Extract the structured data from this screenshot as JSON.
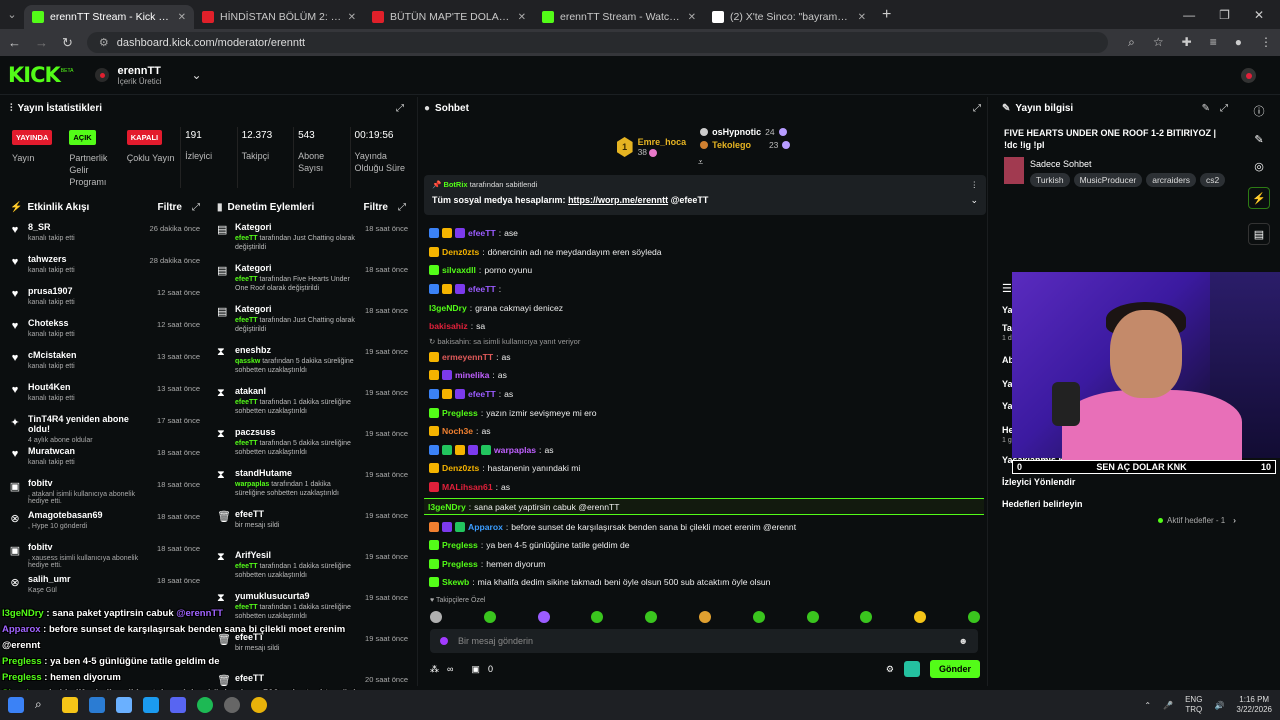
{
  "browser": {
    "tabs": [
      {
        "label": "erennTT Stream - Kick Dashboard",
        "color": "#53fc18",
        "active": true
      },
      {
        "label": "HİNDİSTAN BÖLÜM 2: VARANASİ",
        "color": "#e0202a",
        "active": false
      },
      {
        "label": "BÜTÜN MAP'TE DOLAŞTIK! w/Kendine...",
        "color": "#e0202a",
        "active": false
      },
      {
        "label": "erennTT Stream - Watch Live on Kick",
        "color": "#53fc18",
        "active": false
      },
      {
        "label": "(2) X'te Sinco: \"bayramda 5tl harçlık...",
        "color": "#ffffff",
        "active": false
      }
    ],
    "url": "dashboard.kick.com/moderator/erenntt"
  },
  "header": {
    "logo": "KICK",
    "beta": "BETA",
    "channel_name": "erennTT",
    "channel_role": "İçerik Üretici"
  },
  "stats": {
    "title": "Yayın İstatistikleri",
    "badges": [
      {
        "pill": "YAYINDA",
        "label": "Yayın",
        "color": "red"
      },
      {
        "pill": "AÇIK",
        "label": "Partnerlik Gelir Programı",
        "color": "green"
      },
      {
        "pill": "KAPALI",
        "label": "Çoklu Yayın",
        "color": "red"
      }
    ],
    "numbers": [
      {
        "value": "191",
        "label": "İzleyici"
      },
      {
        "value": "12.373",
        "label": "Takipçi"
      },
      {
        "value": "543",
        "label": "Abone Sayısı"
      },
      {
        "value": "00:19:56",
        "label": "Yayında Olduğu Süre"
      }
    ]
  },
  "activity": {
    "title": "Etkinlik Akışı",
    "filter": "Filtre",
    "items": [
      {
        "icon": "heart-icon",
        "glyph": "♥",
        "who": "8_SR",
        "what": "kanalı takip etti",
        "when": "26 dakika önce"
      },
      {
        "icon": "heart-icon",
        "glyph": "♥",
        "who": "tahwzers",
        "what": "kanalı takip etti",
        "when": "28 dakika önce"
      },
      {
        "icon": "heart-icon",
        "glyph": "♥",
        "who": "prusa1907",
        "what": "kanalı takip etti",
        "when": "12 saat önce"
      },
      {
        "icon": "heart-icon",
        "glyph": "♥",
        "who": "Chotekss",
        "what": "kanalı takip etti",
        "when": "12 saat önce"
      },
      {
        "icon": "heart-icon",
        "glyph": "♥",
        "who": "cMcistaken",
        "what": "kanalı takip etti",
        "when": "13 saat önce"
      },
      {
        "icon": "heart-icon",
        "glyph": "♥",
        "who": "Hout4Ken",
        "what": "kanalı takip etti",
        "when": "13 saat önce"
      },
      {
        "icon": "sparkle-icon",
        "glyph": "✦",
        "who": "TinT4R4 yeniden abone oldu!",
        "what": "4 aylık abone oldular",
        "when": "17 saat önce"
      },
      {
        "icon": "heart-icon",
        "glyph": "♥",
        "who": "Muratwcan",
        "what": "kanalı takip etti",
        "when": "18 saat önce"
      },
      {
        "icon": "gift-icon",
        "glyph": "▣",
        "who": "fobitv",
        "what": ", atakanl isimli kullanıcıya abonelik hediye etti.",
        "when": "18 saat önce"
      },
      {
        "icon": "hype-icon",
        "glyph": "⊗",
        "who": "Amagotebasan69",
        "what": ", Hype 10 gönderdi",
        "when": "18 saat önce"
      },
      {
        "icon": "gift-icon",
        "glyph": "▣",
        "who": "fobitv",
        "what": ", xausess isimli kullanıcıya abonelik hediye etti.",
        "when": "18 saat önce"
      },
      {
        "icon": "hype-icon",
        "glyph": "⊗",
        "who": "salih_umr",
        "what": "Kaşe Gül",
        "when": "18 saat önce"
      }
    ]
  },
  "moderation": {
    "title": "Denetim Eylemleri",
    "filter": "Filtre",
    "items": [
      {
        "icon": "category-icon",
        "glyph": "▤",
        "who": "Kategori",
        "actor": "efeeTT",
        "what": " tarafından Just Chatting olarak değiştirildi",
        "when": "18 saat önce"
      },
      {
        "icon": "category-icon",
        "glyph": "▤",
        "who": "Kategori",
        "actor": "efeeTT",
        "what": " tarafından Five Hearts Under One Roof olarak değiştirildi",
        "when": "18 saat önce"
      },
      {
        "icon": "category-icon",
        "glyph": "▤",
        "who": "Kategori",
        "actor": "efeeTT",
        "what": " tarafından Just Chatting olarak değiştirildi",
        "when": "18 saat önce"
      },
      {
        "icon": "hourglass-icon",
        "glyph": "⧗",
        "who": "eneshbz",
        "actor": "qasskw",
        "what": " tarafından 5 dakika süreliğine sohbetten uzaklaştırıldı",
        "when": "19 saat önce"
      },
      {
        "icon": "hourglass-icon",
        "glyph": "⧗",
        "who": "atakanl",
        "actor": "efeeTT",
        "what": " tarafından 1 dakika süreliğine sohbetten uzaklaştırıldı",
        "when": "19 saat önce"
      },
      {
        "icon": "hourglass-icon",
        "glyph": "⧗",
        "who": "paczsuss",
        "actor": "efeeTT",
        "what": " tarafından 5 dakika süreliğine sohbetten uzaklaştırıldı",
        "when": "19 saat önce"
      },
      {
        "icon": "hourglass-icon",
        "glyph": "⧗",
        "who": "standHutame",
        "actor": "warpaplas",
        "what": " tarafından 1 dakika süreliğine sohbetten uzaklaştırıldı",
        "when": "19 saat önce"
      },
      {
        "icon": "trash-icon",
        "glyph": "🗑",
        "who": "efeeTT",
        "actor": "",
        "what": "bir mesajı sildi",
        "when": "19 saat önce"
      },
      {
        "icon": "hourglass-icon",
        "glyph": "⧗",
        "who": "ArifYesil",
        "actor": "efeeTT",
        "what": " tarafından 1 dakika süreliğine sohbetten uzaklaştırıldı",
        "when": "19 saat önce"
      },
      {
        "icon": "hourglass-icon",
        "glyph": "⧗",
        "who": "yumuklusucurta9",
        "actor": "efeeTT",
        "what": " tarafından 1 dakika süreliğine sohbetten uzaklaştırıldı",
        "when": "19 saat önce"
      },
      {
        "icon": "trash-icon",
        "glyph": "🗑",
        "who": "efeeTT",
        "actor": "",
        "what": "bir mesajı sildi",
        "when": "19 saat önce"
      },
      {
        "icon": "trash-icon",
        "glyph": "🗑",
        "who": "efeeTT",
        "actor": "",
        "what": "bir mesajı sildi",
        "when": "20 saat önce"
      }
    ]
  },
  "chat": {
    "title": "Sohbet",
    "top_gifters": [
      {
        "name": "Emre_hoca",
        "count": "38",
        "rank": "1"
      },
      {
        "name": "osHypnotic",
        "count": "24",
        "rank": "2"
      },
      {
        "name": "Tekolego",
        "count": "23",
        "rank": "3"
      }
    ],
    "pinned_by": "BotRix",
    "pinned_suffix": "tarafından sabitlendi",
    "pinned_text": "Tüm sosyal medya hesaplarım: ",
    "pinned_link": "https://worp.me/erenntt",
    "pinned_mention": " @efeeTT",
    "messages": [
      {
        "user": "efeeTT",
        "color": "#9b5cff",
        "text": "ase",
        "badges": [
          "#3b82f6",
          "#f5b400",
          "#7c3aed"
        ]
      },
      {
        "user": "Denz0zts",
        "color": "#f5b400",
        "text": "dönercinin adı ne meydandayım eren söyleda",
        "badges": [
          "#f5b400"
        ]
      },
      {
        "user": "silvaxdll",
        "color": "#53fc18",
        "text": "porno oyunu",
        "badges": [
          "#53fc18"
        ]
      },
      {
        "user": "efeeTT",
        "color": "#9b5cff",
        "text": "",
        "badges": [
          "#3b82f6",
          "#f5b400",
          "#7c3aed"
        ]
      },
      {
        "user": "l3geNDry",
        "color": "#53fc18",
        "text": "grana cakmayi denicez",
        "badges": []
      },
      {
        "user": "bakisahiz",
        "color": "#e0203a",
        "text": "sa",
        "badges": []
      },
      {
        "user": "",
        "color": "#999",
        "text": "↻ bakisahin: sa isimli kullanıcıya yanıt veriyor",
        "badges": [],
        "reply": true
      },
      {
        "user": "ermeyennTT",
        "color": "#e05a5a",
        "text": "as",
        "badges": [
          "#f5b400"
        ]
      },
      {
        "user": "minelika",
        "color": "#c060ff",
        "text": "as",
        "badges": [
          "#f5b400",
          "#7c3aed"
        ]
      },
      {
        "user": "efeeTT",
        "color": "#9b5cff",
        "text": "as",
        "badges": [
          "#3b82f6",
          "#f5b400",
          "#7c3aed"
        ]
      },
      {
        "user": "Pregless",
        "color": "#53fc18",
        "text": "yazın izmir sevişmeye mi ero",
        "badges": [
          "#53fc18"
        ]
      },
      {
        "user": "Noch3e",
        "color": "#f08030",
        "text": "as",
        "badges": [
          "#f5b400"
        ]
      },
      {
        "user": "warpaplas",
        "color": "#c060ff",
        "text": "as",
        "badges": [
          "#3b82f6",
          "#22c55e",
          "#f5b400",
          "#7c3aed",
          "#22c55e"
        ]
      },
      {
        "user": "Denz0zts",
        "color": "#f5b400",
        "text": "hastanenin yanındaki mi",
        "badges": [
          "#f5b400"
        ]
      },
      {
        "user": "MALihsan61",
        "color": "#e0203a",
        "text": "as",
        "badges": [
          "#e0203a"
        ]
      },
      {
        "user": "l3geNDry",
        "color": "#53fc18",
        "text": "sana paket yaptirsin cabuk @erennTT",
        "badges": [],
        "hl": true
      },
      {
        "user": "Apparox",
        "color": "#3b9dff",
        "text": "before sunset de karşılaşırsak benden sana bi çilekli moet erenim @erennt",
        "badges": [
          "#f08030",
          "#7c3aed",
          "#22c55e"
        ]
      },
      {
        "user": "Pregless",
        "color": "#53fc18",
        "text": "ya ben 4-5 günlüğüne tatile geldim de",
        "badges": [
          "#53fc18"
        ]
      },
      {
        "user": "Pregless",
        "color": "#53fc18",
        "text": "hemen diyorum",
        "badges": [
          "#53fc18"
        ]
      },
      {
        "user": "Skewb",
        "color": "#53fc18",
        "text": "mia khalifa dedim sikine takmadı beni öyle olsun 500 sub atcaktım öyle olsun",
        "badges": [
          "#53fc18"
        ]
      }
    ],
    "follow_mode": "Takipçilere Özel",
    "input_placeholder": "Bir mesaj gönderin",
    "points": "∞",
    "gift_count": "0",
    "send_label": "Gönder"
  },
  "stream_info": {
    "title": "Yayın bilgisi",
    "stream_title": "FIVE HEARTS UNDER ONE ROOF 1-2 BITIRIYOZ | !dc !ig !pl",
    "category": "Sadece Sohbet",
    "tags": [
      "Turkish",
      "MusicProducer",
      "arcraiders",
      "cs2"
    ]
  },
  "lower_panel": {
    "rows": [
      "Ya",
      "Tal",
      "1 dk",
      "Ab",
      "Ya",
      "Ya",
      "He",
      "1 gün",
      "Yasaklanmış kelimeler",
      "İzleyici Yönlendir",
      "Hedefleri belirleyin"
    ],
    "goal_status": "Aktif hedefler - 1"
  },
  "goal_overlay": {
    "left": "0",
    "center": "SEN AÇ DOLAR KNK",
    "right": "10"
  },
  "chat_overlay": [
    {
      "user": "l3geNDry",
      "text": " : sana paket yaptirsin cabuk ",
      "mention": "@erennTT"
    },
    {
      "user": "Apparox",
      "text": " : before sunset de karşılaşırsak benden sana bi çilekli moet erenim",
      "mention": ""
    },
    {
      "user": "",
      "text": "@erennt",
      "mention": ""
    },
    {
      "user": "Pregless",
      "text": " : ya ben 4-5 günlüğüne tatile geldim de",
      "mention": ""
    },
    {
      "user": "Pregless",
      "text": " : hemen diyorum",
      "mention": ""
    },
    {
      "user": "Skewb",
      "text": " : mia khalifa dedim sikine takmadı beni öyle olsun 500 sub atcaktım öyle",
      "mention": ""
    },
    {
      "user": "",
      "text": "olsun",
      "mention": ""
    }
  ],
  "taskbar": {
    "lang": "ENG",
    "lang2": "TRQ",
    "time": "1:16 PM",
    "date": "3/22/2026"
  }
}
